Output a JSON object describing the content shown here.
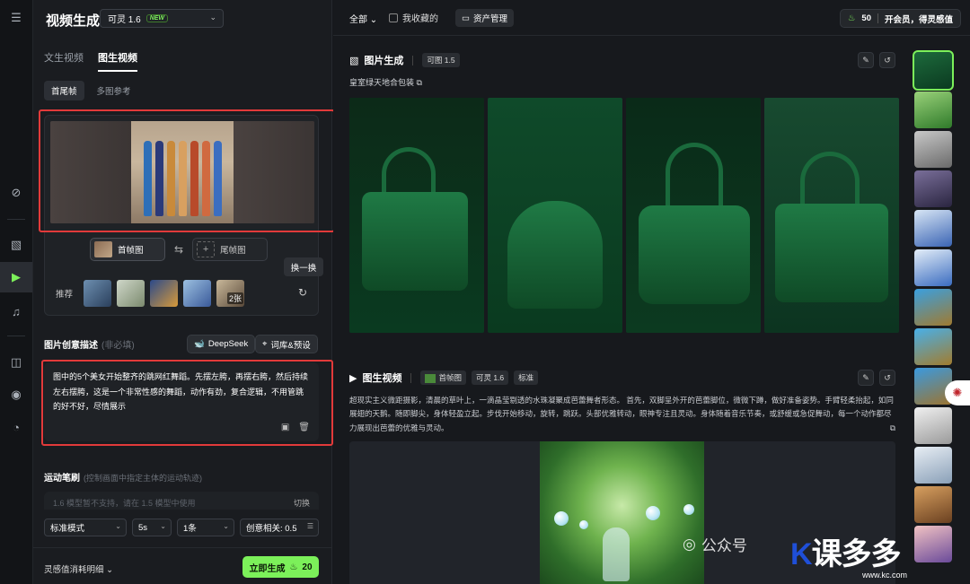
{
  "app": {
    "title": "视频生成",
    "model": "可灵 1.6",
    "new_badge": "NEW"
  },
  "tabs": [
    "文生视频",
    "图生视频"
  ],
  "subtabs": [
    "首尾帧",
    "多图参考"
  ],
  "frames": {
    "first": "首帧图",
    "last": "尾帧图",
    "tooltip": "换一换"
  },
  "recommend": {
    "label": "推荐",
    "more": "2张"
  },
  "description": {
    "title": "图片创意描述",
    "optional": "(非必填)",
    "deepseek": "DeepSeek",
    "library": "词库&预设",
    "text": "图中的5个美女开始整齐的跳网红舞蹈。先摆左胯，再摆右胯，然后持续左右摆胯，这是一个非常性感的舞蹈，动作有劲，复合逻辑，不用管跳的好不好，尽情展示"
  },
  "motion": {
    "title": "运动笔刷",
    "subtitle": "(控制画面中指定主体的运动轨迹)",
    "placeholder": "1.6 模型暂不支持，请在 1.5 模型中使用",
    "switch": "切换"
  },
  "settings": {
    "mode": "标准模式",
    "duration": "5s",
    "count": "1条",
    "creativity": "创意相关: 0.5"
  },
  "footer": {
    "cost_label": "灵感值消耗明细",
    "generate": "立即生成",
    "cost": "20"
  },
  "topbar": {
    "all": "全部",
    "favorites": "我收藏的",
    "assets": "资产管理",
    "points": "50",
    "vip": "开会员，得灵感值"
  },
  "image_block": {
    "title": "图片生成",
    "model": "可图 1.5",
    "prompt": "皇室绿天地合包装"
  },
  "video_block": {
    "title": "图生视频",
    "frame_tag": "首帧图",
    "model": "可灵 1.6",
    "quality": "标准",
    "prompt": "超现实主义微距摄影，清晨的草叶上，一滴晶莹剔透的水珠凝聚成芭蕾舞者形态。 首先，双脚呈外开的芭蕾脚位，微微下蹲，做好准备姿势。手臂轻柔抬起，如同展翅的天鹅。随即脚尖，身体轻盈立起。步伐开始移动，旋转，跳跃。头部优雅转动，眼神专注且灵动。身体随着音乐节奏，或舒缓或急促舞动，每一个动作都尽力展现出芭蕾的优雅与灵动。"
  },
  "watermark": {
    "text": "公众号",
    "brand": "课多多",
    "url": "www.kc.com"
  },
  "colors": {
    "accent": "#7cf05a",
    "highlight": "#e23a3a",
    "background": "#16181c"
  },
  "icons": [
    "menu-icon",
    "image-icon",
    "video-icon",
    "audio-icon",
    "settings-icon",
    "eye-icon",
    "history-icon",
    "refresh-icon",
    "swap-icon",
    "save-icon",
    "trash-icon",
    "edit-icon",
    "redo-icon",
    "copy-icon",
    "folder-icon",
    "flame-icon"
  ]
}
